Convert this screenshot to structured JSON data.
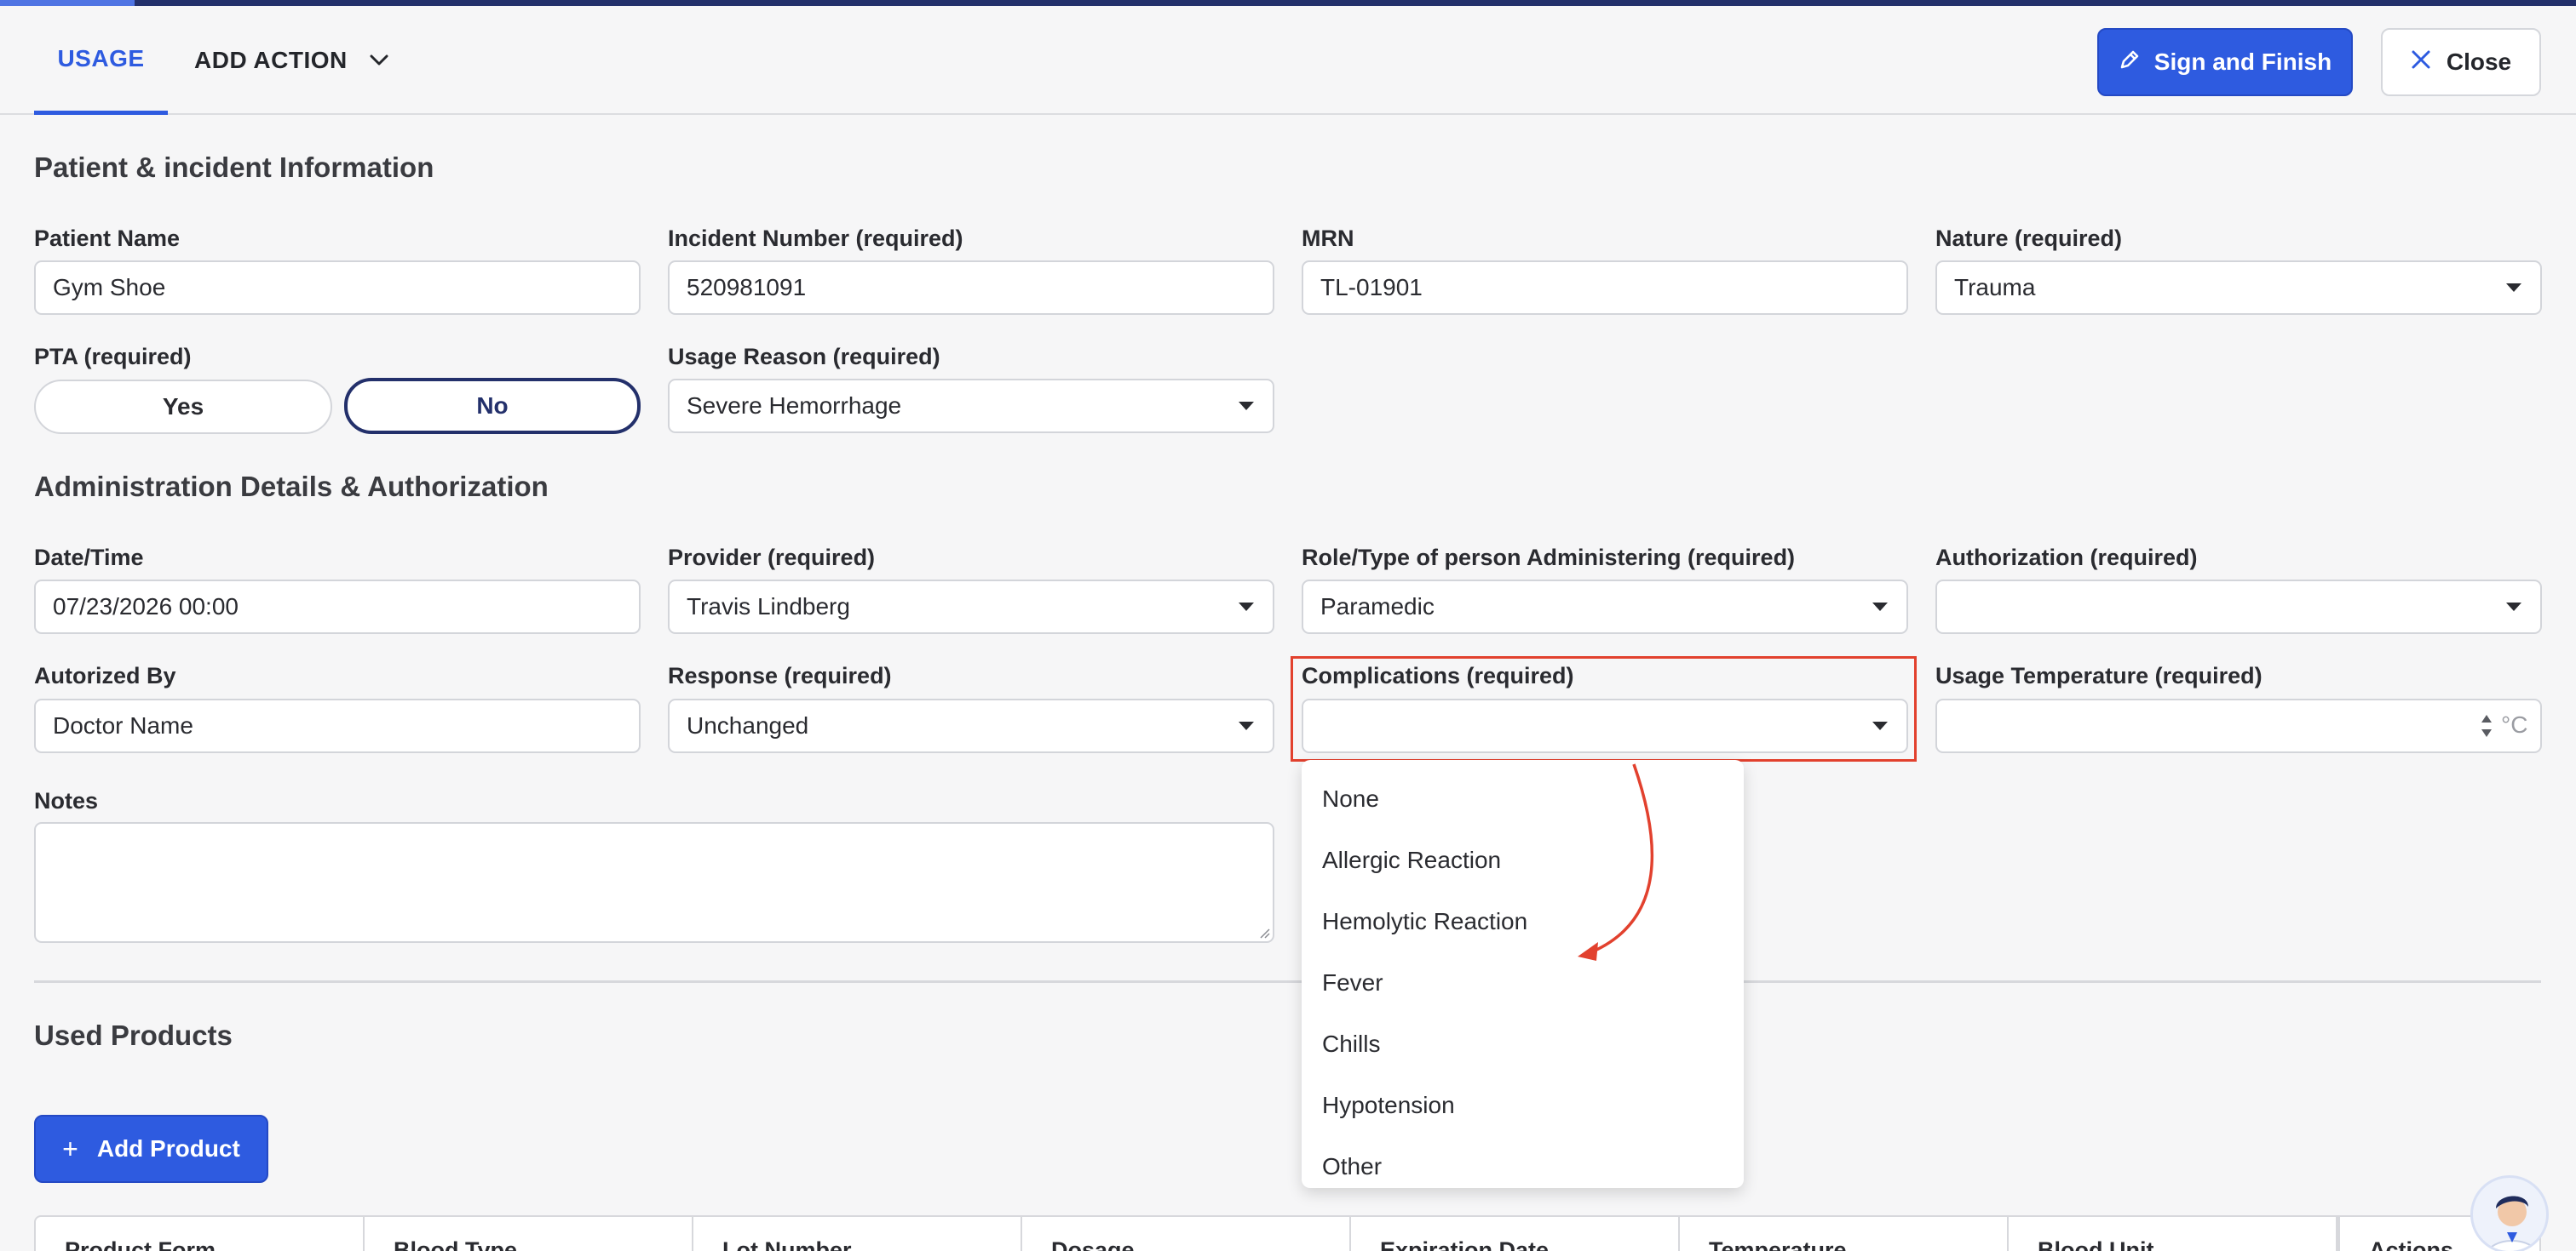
{
  "header": {
    "tabs": [
      {
        "label": "USAGE",
        "active": true
      },
      {
        "label": "ADD ACTION",
        "active": false
      }
    ],
    "sign_label": "Sign and Finish",
    "close_label": "Close"
  },
  "sections": {
    "patient": "Patient & incident Information",
    "admin": "Administration Details & Authorization",
    "products": "Used Products"
  },
  "fields": {
    "patient_name": {
      "label": "Patient Name",
      "value": "Gym Shoe"
    },
    "incident_number": {
      "label": "Incident Number (required)",
      "value": "520981091"
    },
    "mrn": {
      "label": "MRN",
      "value": "TL-01901"
    },
    "nature": {
      "label": "Nature (required)",
      "value": "Trauma"
    },
    "pta": {
      "label": "PTA (required)",
      "yes": "Yes",
      "no": "No",
      "selected": "No"
    },
    "usage_reason": {
      "label": "Usage Reason (required)",
      "value": "Severe Hemorrhage"
    },
    "date_time": {
      "label": "Date/Time",
      "value": "07/23/2026 00:00"
    },
    "provider": {
      "label": "Provider (required)",
      "value": "Travis Lindberg"
    },
    "role": {
      "label": "Role/Type of person Administering (required)",
      "value": "Paramedic"
    },
    "authorization": {
      "label": "Authorization (required)",
      "value": ""
    },
    "authorized_by": {
      "label": "Autorized By",
      "value": "Doctor Name"
    },
    "response": {
      "label": "Response (required)",
      "value": "Unchanged"
    },
    "complications": {
      "label": "Complications (required)",
      "value": ""
    },
    "usage_temperature": {
      "label": "Usage Temperature (required)",
      "value": "",
      "unit": "°C"
    },
    "notes": {
      "label": "Notes",
      "value": ""
    }
  },
  "complications_options": [
    "None",
    "Allergic Reaction",
    "Hemolytic Reaction",
    "Fever",
    "Chills",
    "Hypotension",
    "Other"
  ],
  "add_product_label": "Add Product",
  "table_headers": [
    "Product Form",
    "Blood Type",
    "Lot Number",
    "Dosage",
    "Expiration Date",
    "Temperature",
    "Blood Unit",
    "Actions"
  ],
  "colors": {
    "accent": "#2e5be0",
    "navy": "#23306b",
    "annotation": "#e2412e",
    "background": "#f6f6f7"
  }
}
